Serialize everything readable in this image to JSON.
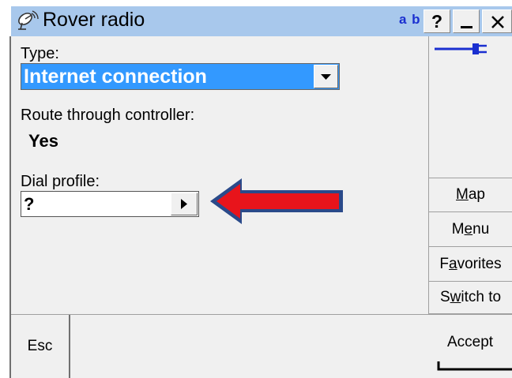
{
  "window": {
    "title": "Rover radio",
    "input_mode": "a b",
    "buttons": {
      "help": "?",
      "minimize": "_",
      "close": "✕"
    }
  },
  "form": {
    "type_label": "Type:",
    "type_value": "Internet connection",
    "route_label": "Route through controller:",
    "route_value": "Yes",
    "dial_label": "Dial profile:",
    "dial_value": "?"
  },
  "sidebar": {
    "status_icon": "plug-connected-icon",
    "buttons": [
      {
        "pre": "",
        "key": "M",
        "post": "ap"
      },
      {
        "pre": "M",
        "key": "e",
        "post": "nu"
      },
      {
        "pre": "F",
        "key": "a",
        "post": "vorites"
      },
      {
        "pre": "S",
        "key": "w",
        "post": "itch to"
      }
    ]
  },
  "footer": {
    "esc_label": "Esc",
    "accept_label": "Accept"
  },
  "colors": {
    "title_bar": "#a8c8ec",
    "selection": "#3399ff",
    "annotation_arrow": "#e8141b",
    "annotation_outline": "#2a4a8a",
    "plug_icon": "#1a2fd0"
  }
}
